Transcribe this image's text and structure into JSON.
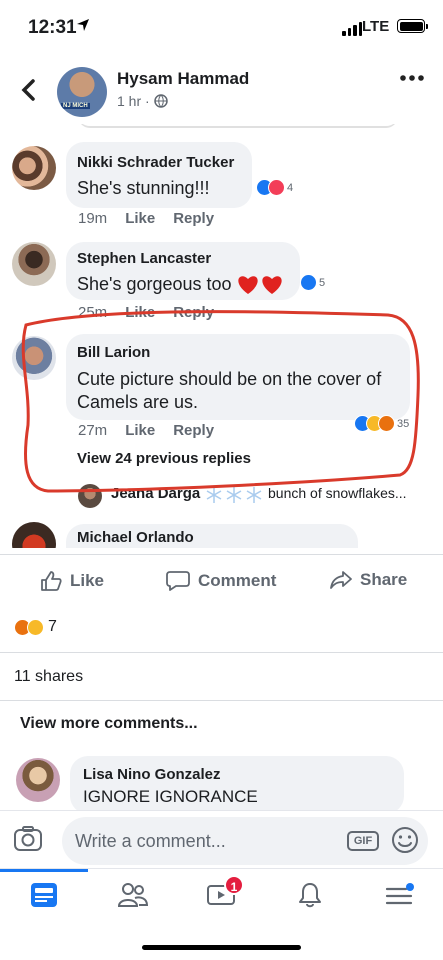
{
  "status": {
    "time": "12:31",
    "network": "LTE"
  },
  "header": {
    "title": "Hysam Hammad",
    "subtitle": "1 hr ·",
    "avatar_tag": "NJ MICH"
  },
  "comments": [
    {
      "name": "Nikki Schrader Tucker",
      "text": "She's stunning!!!",
      "time": "19m",
      "like": "Like",
      "reply": "Reply",
      "reaction_count": "4"
    },
    {
      "name": "Stephen Lancaster",
      "text": "She's gorgeous too",
      "time": "25m",
      "like": "Like",
      "reply": "Reply",
      "reaction_count": "5"
    },
    {
      "name": "Bill Larion",
      "text_line1": "Cute picture should be on the cover of",
      "text_line2": "Camels are us.",
      "time": "27m",
      "like": "Like",
      "reply": "Reply",
      "reaction_count": "35",
      "view_replies": "View 24 previous replies"
    },
    {
      "name": "Jeana Darga",
      "text": "bunch of snowflakes..."
    },
    {
      "name": "Michael Orlando"
    }
  ],
  "actions": {
    "like": "Like",
    "comment": "Comment",
    "share": "Share"
  },
  "reaction_summary": {
    "count": "7"
  },
  "shares": "11 shares",
  "view_more": "View more comments...",
  "preview_comment": {
    "name": "Lisa Nino Gonzalez",
    "text": "IGNORE IGNORANCE"
  },
  "composer": {
    "placeholder": "Write a comment...",
    "gif": "GIF"
  },
  "tabs": {
    "video_badge": "1"
  },
  "colors": {
    "brand": "#1877f2",
    "annotation": "#d93a2b",
    "badge": "#e41e3f"
  },
  "icons": [
    "back-icon",
    "more-icon",
    "globe-icon",
    "like-icon",
    "comment-icon",
    "share-icon",
    "camera-icon",
    "gif-icon",
    "emoji-icon",
    "news-feed-icon",
    "friends-icon",
    "watch-icon",
    "notifications-icon",
    "menu-icon"
  ]
}
